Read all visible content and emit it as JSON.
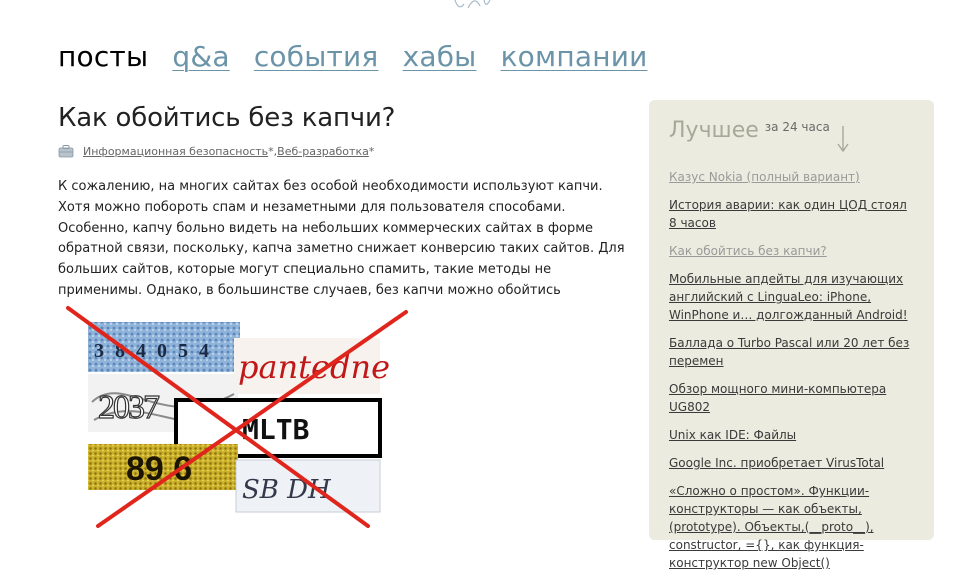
{
  "nav": {
    "items": [
      {
        "label": "посты",
        "active": true
      },
      {
        "label": "q&a",
        "active": false
      },
      {
        "label": "события",
        "active": false
      },
      {
        "label": "хабы",
        "active": false
      },
      {
        "label": "компании",
        "active": false
      }
    ]
  },
  "post": {
    "title": "Как обойтись без капчи?",
    "hub_icon": "briefcase-icon",
    "hubs": [
      {
        "label": "Информационная безопасность",
        "mark": "*"
      },
      {
        "label": "Веб-разработка",
        "mark": "*"
      }
    ],
    "hub_separator": ", ",
    "text": "К сожалению, на многих сайтах без особой необходимости используют капчи. Хотя можно побороть спам и незаметными для пользователя способами. Особенно, капчу больно видеть на небольших коммерческих сайтах в форме обратной связи, поскольку, капча заметно снижает конверсию таких сайтов. Для больших сайтов, которые могут специально спамить, такие методы не применимы. Однако, в большинстве случаев, без капчи можно обойтись",
    "image": {
      "description": "crossed-out-captcha-collage",
      "captcha_texts": [
        "3 8 4 0 5 4",
        "pantedne",
        "2037",
        "MLTB",
        "89 6",
        "SB DH"
      ]
    }
  },
  "sidebar": {
    "title": "Лучшее",
    "period": "за 24 часа",
    "arrow_icon": "arrow-down-icon",
    "items": [
      {
        "label": "Казус Nokia (полный вариант)",
        "visited": true
      },
      {
        "label": "История аварии: как один ЦОД стоял 8 часов",
        "visited": false
      },
      {
        "label": "Как обойтись без капчи?",
        "visited": true
      },
      {
        "label": "Мобильные апдейты для изучающих английский с LinguaLeo: iPhone, WinPhone и… долгожданный Android!",
        "visited": false
      },
      {
        "label": "Баллада о Turbo Pascal или 20 лет без перемен",
        "visited": false
      },
      {
        "label": "Обзор мощного мини-компьютера UG802",
        "visited": false
      },
      {
        "label": "Unix как IDE: Файлы",
        "visited": false
      },
      {
        "label": "Google Inc. приобретает VirusTotal",
        "visited": false
      },
      {
        "label": "«Сложно о простом». Функции-конструкторы — как объекты,(prototype). Объекты,(__proto__), constructor, ={}, как функция-конструктор new Object()",
        "visited": false
      }
    ]
  },
  "colors": {
    "nav_link": "#6b94a8",
    "sidebar_bg": "#ebebdf",
    "cross": "#e0261c"
  }
}
